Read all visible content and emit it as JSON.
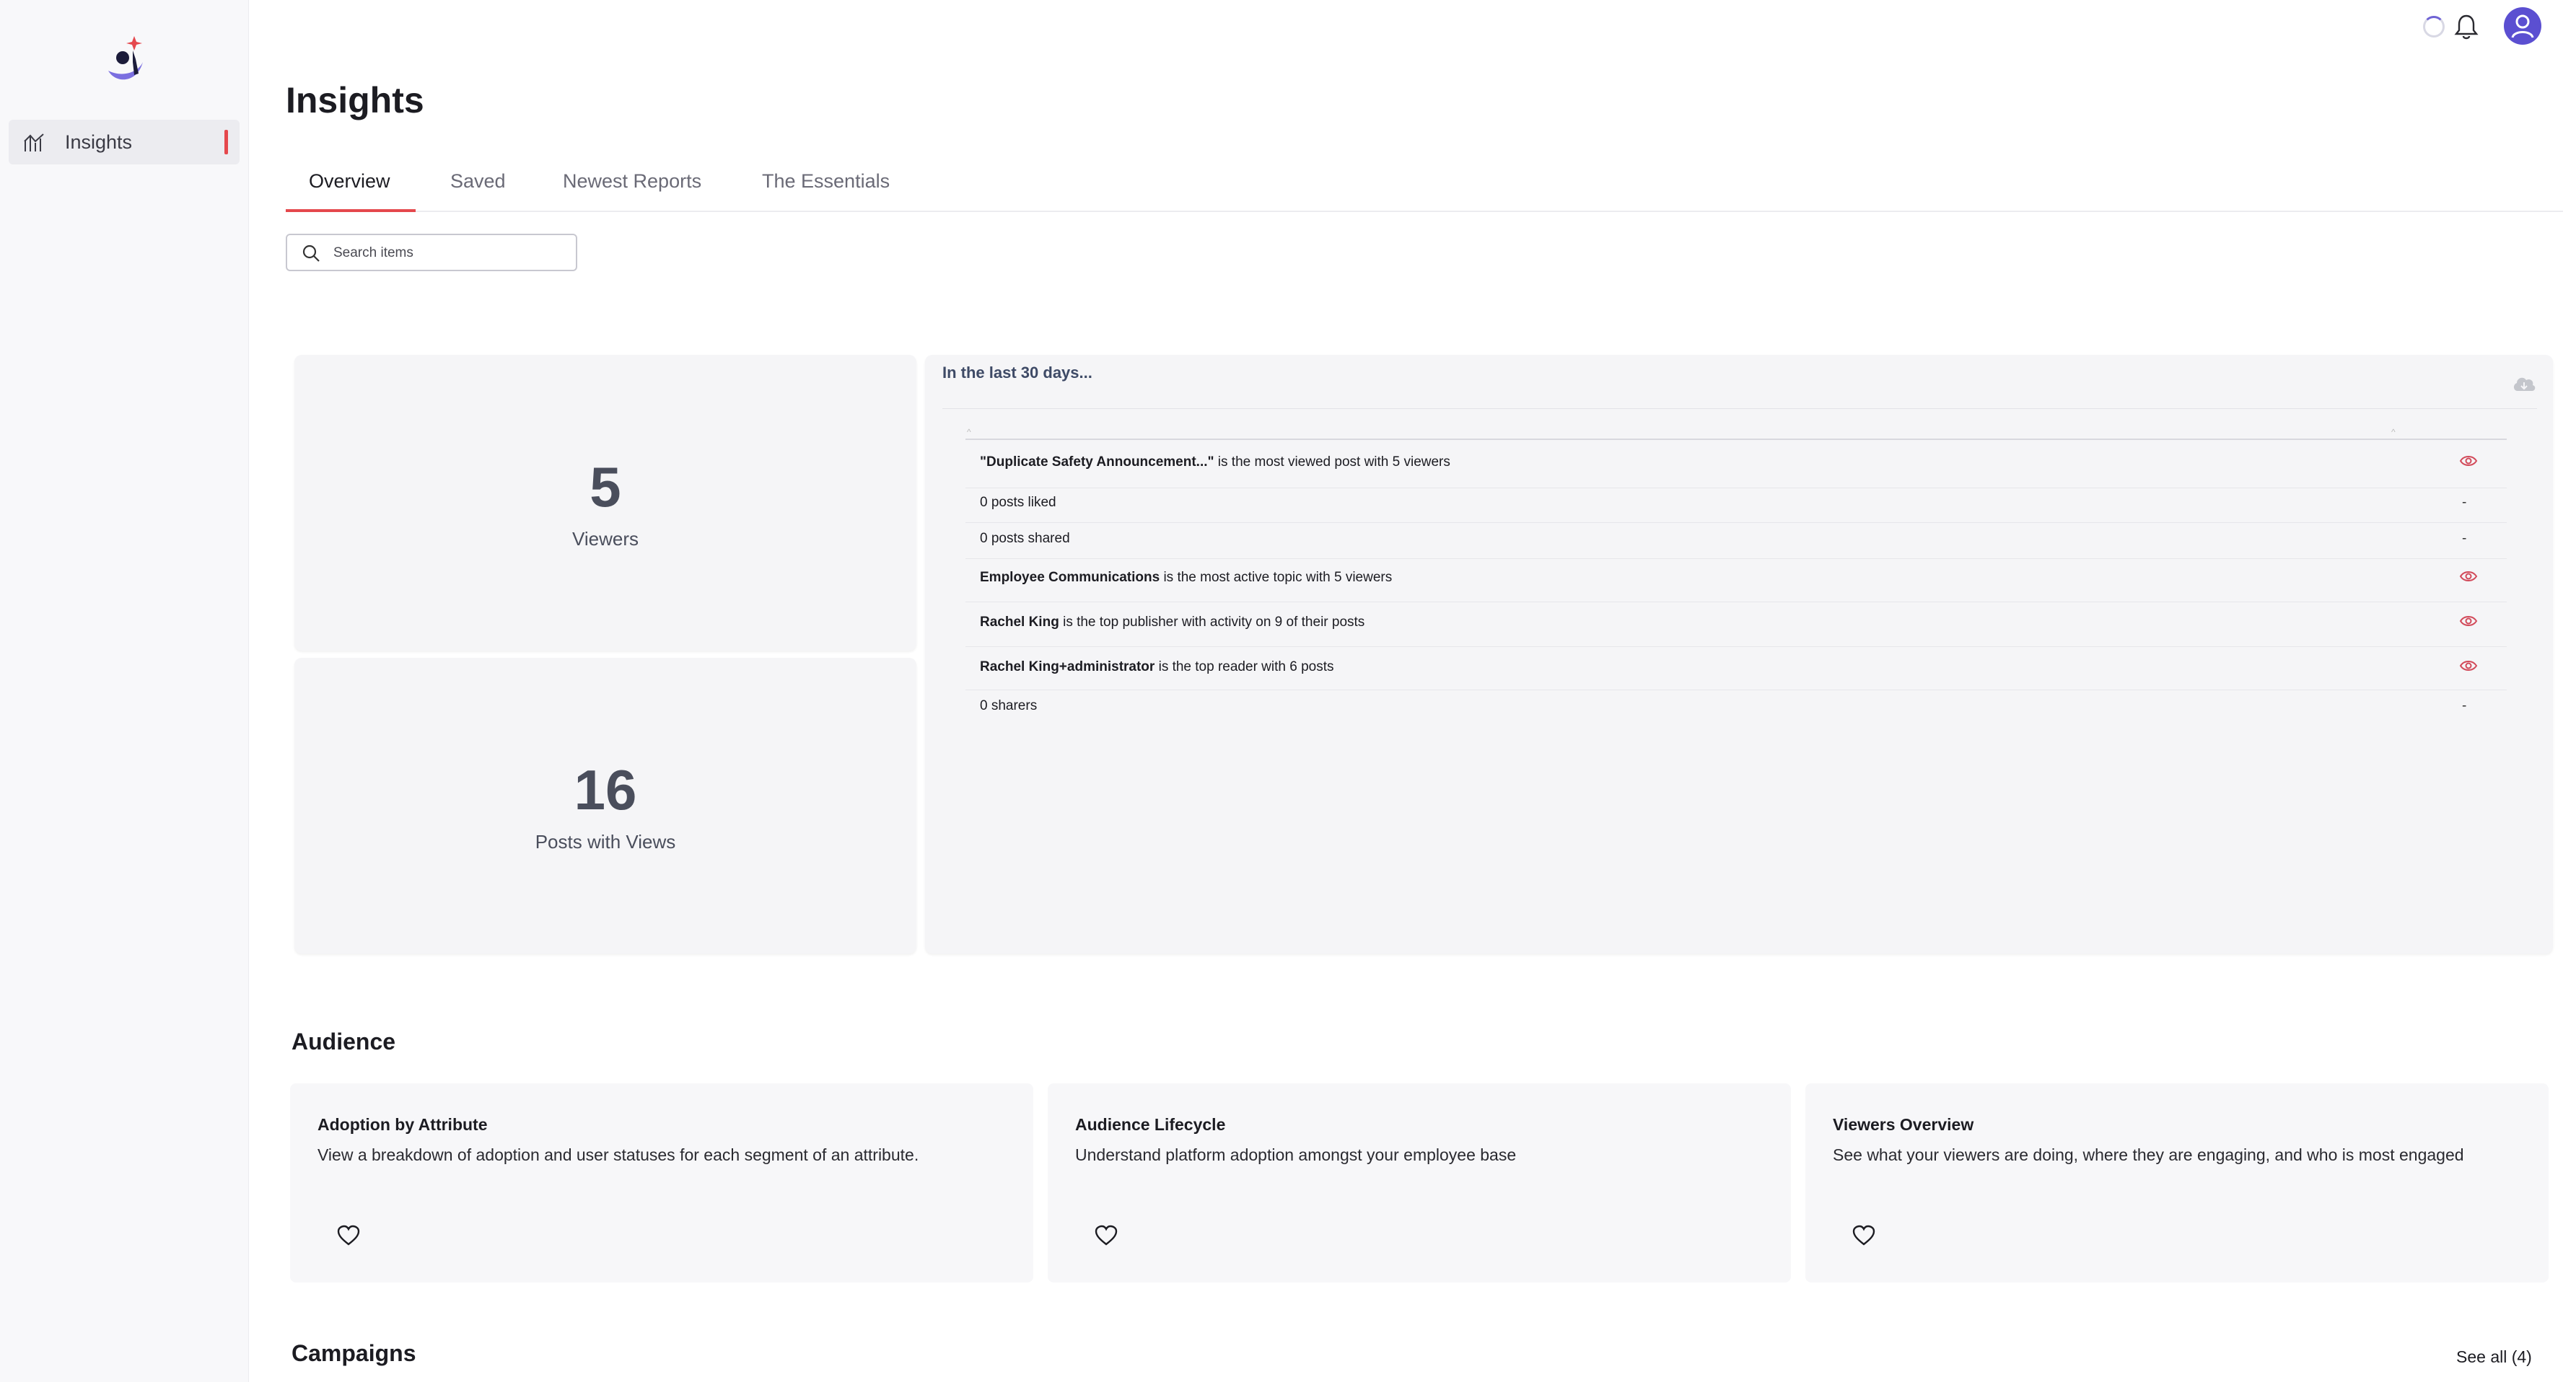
{
  "sidebar": {
    "items": [
      {
        "label": "Insights",
        "icon": "chart-icon"
      }
    ]
  },
  "header": {
    "title": "Insights",
    "tabs": [
      {
        "label": "Overview",
        "active": true
      },
      {
        "label": "Saved",
        "active": false
      },
      {
        "label": "Newest Reports",
        "active": false
      },
      {
        "label": "The Essentials",
        "active": false
      }
    ]
  },
  "search": {
    "placeholder": "Search items",
    "value": ""
  },
  "stats": [
    {
      "value": "5",
      "label": "Viewers"
    },
    {
      "value": "16",
      "label": "Posts with Views"
    }
  ],
  "panel": {
    "title": "In the last 30 days...",
    "rows": [
      {
        "bold": "\"Duplicate Safety Announcement...\"",
        "text": " is the most viewed post with 5 viewers",
        "action": "view"
      },
      {
        "bold": "",
        "text": "0 posts liked",
        "action": "-"
      },
      {
        "bold": "",
        "text": "0 posts shared",
        "action": "-"
      },
      {
        "bold": "Employee Communications",
        "text": " is the most active topic with 5 viewers",
        "action": "view"
      },
      {
        "bold": "Rachel King",
        "text": " is the top publisher with activity on 9 of their posts",
        "action": "view"
      },
      {
        "bold": "Rachel King+administrator",
        "text": " is the top reader with 6 posts",
        "action": "view"
      },
      {
        "bold": "",
        "text": "0 sharers",
        "action": "-"
      }
    ]
  },
  "audience": {
    "title": "Audience",
    "cards": [
      {
        "title": "Adoption by Attribute",
        "desc": "View a breakdown of adoption and user statuses for each segment of an attribute."
      },
      {
        "title": "Audience Lifecycle",
        "desc": "Understand platform adoption amongst your employee base"
      },
      {
        "title": "Viewers Overview",
        "desc": "See what your viewers are doing, where they are engaging, and who is most engaged"
      }
    ]
  },
  "campaigns": {
    "title": "Campaigns",
    "see_all": "See all (4)"
  },
  "colors": {
    "accent": "#e5484d",
    "avatar": "#5b4fd1",
    "text": "#1c1c22"
  }
}
